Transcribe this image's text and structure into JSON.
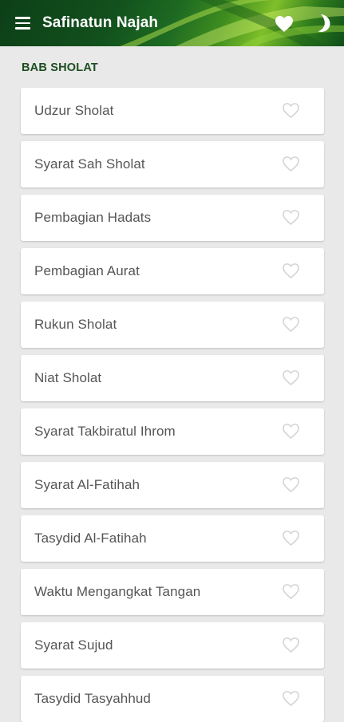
{
  "appbar": {
    "title": "Safinatun Najah",
    "menu_icon": "hamburger-menu-icon",
    "favorites_icon": "heart-filled-icon",
    "night_mode_icon": "crescent-moon-icon"
  },
  "section": {
    "title": "BAB SHOLAT"
  },
  "items": [
    {
      "label": "Udzur Sholat"
    },
    {
      "label": "Syarat Sah Sholat"
    },
    {
      "label": "Pembagian Hadats"
    },
    {
      "label": "Pembagian Aurat"
    },
    {
      "label": "Rukun Sholat"
    },
    {
      "label": "Niat Sholat"
    },
    {
      "label": "Syarat Takbiratul Ihrom"
    },
    {
      "label": "Syarat Al-Fatihah"
    },
    {
      "label": "Tasydid Al-Fatihah"
    },
    {
      "label": "Waktu Mengangkat Tangan"
    },
    {
      "label": "Syarat Sujud"
    },
    {
      "label": "Tasydid Tasyahhud"
    }
  ],
  "colors": {
    "section_title": "#1b4d21",
    "background": "#e9e9e9",
    "heart_outline": "#d3d3d3"
  }
}
